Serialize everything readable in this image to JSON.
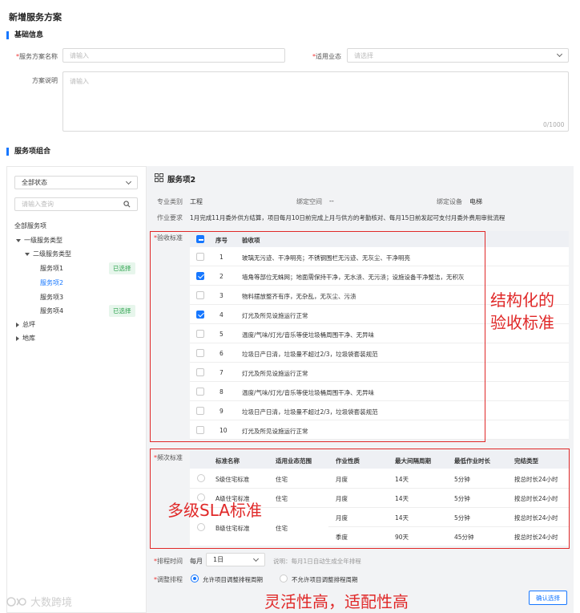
{
  "page_title": "新增服务方案",
  "basic": {
    "section_title": "基础信息",
    "name_label": "服务方案名称",
    "name_placeholder": "请输入",
    "biz_label": "适用业态",
    "biz_placeholder": "请选择",
    "desc_label": "方案说明",
    "desc_placeholder": "请输入",
    "desc_counter": "0/1000"
  },
  "combo": {
    "section_title": "服务项组合",
    "status_select": "全部状态",
    "search_placeholder": "请输入查询",
    "tree": {
      "root": "全部服务项",
      "level1": "一级服务类型",
      "level2": "二级服务类型",
      "items": [
        {
          "label": "服务项1",
          "tag": "已选择"
        },
        {
          "label": "服务项2",
          "tag": ""
        },
        {
          "label": "服务项3",
          "tag": ""
        },
        {
          "label": "服务项4",
          "tag": "已选择"
        }
      ],
      "other1": "总坪",
      "other2": "地库"
    }
  },
  "detail": {
    "title": "服务项2",
    "major_label": "专业类别",
    "major_value": "工程",
    "space_label": "绑定空间",
    "space_value": "--",
    "device_label": "绑定设备",
    "device_value": "电梯",
    "req_label": "作业要求",
    "req_value": "1月完成11月委外供方结算，项目每月10日前完成上月与供方的考勤核对、每月15日前发起可支付月委外费用审批流程",
    "accept_label": "验收标准",
    "accept_headers": {
      "no": "序号",
      "item": "验收项"
    },
    "accept_rows": [
      {
        "no": "1",
        "text": "玻璃无污迹、干净明亮；不锈钢围栏无污迹、无灰尘、干净明亮",
        "checked": false
      },
      {
        "no": "2",
        "text": "墙角等部位无蛛网；地面需保持干净，无水渍、无污渍；设施设备干净整洁，无积灰",
        "checked": true
      },
      {
        "no": "3",
        "text": "物料摆放整齐有序，无杂乱，无灰尘、污渍",
        "checked": false
      },
      {
        "no": "4",
        "text": "灯光及所见设施运行正常",
        "checked": true
      },
      {
        "no": "5",
        "text": "温度/气味/灯光/音乐等使垃圾桶周围干净、无异味",
        "checked": false
      },
      {
        "no": "6",
        "text": "垃圾日产日清，垃圾量不超过2/3，垃圾袋套装规范",
        "checked": false
      },
      {
        "no": "7",
        "text": "灯光及所见设施运行正常",
        "checked": false
      },
      {
        "no": "8",
        "text": "温度/气味/灯光/音乐等使垃圾桶周围干净、无异味",
        "checked": false
      },
      {
        "no": "9",
        "text": "垃圾日产日清，垃圾量不超过2/3，垃圾袋套装规范",
        "checked": false
      },
      {
        "no": "10",
        "text": "灯光及所见设施运行正常",
        "checked": false
      }
    ],
    "freq_label": "频次标准",
    "freq_headers": [
      "标准名称",
      "适用业态范围",
      "作业性质",
      "最大间隔周期",
      "最低作业时长",
      "完结类型"
    ],
    "freq_rows": [
      {
        "name": "S级住宅标准",
        "scope": "住宅",
        "nature": "月度",
        "cycle": "14天",
        "dur": "5分钟",
        "end": "按总时长24小时"
      },
      {
        "name": "A级住宅标准",
        "scope": "住宅",
        "nature": "月度",
        "cycle": "14天",
        "dur": "5分钟",
        "end": "按总时长24小时"
      },
      {
        "name": "",
        "scope": "",
        "nature": "月度",
        "cycle": "14天",
        "dur": "5分钟",
        "end": "按总时长24小时"
      },
      {
        "name": "B级住宅标准",
        "scope": "住宅",
        "nature": "季度",
        "cycle": "90天",
        "dur": "45分钟",
        "end": "按总时长24小时"
      }
    ],
    "sched_label": "排程时间",
    "sched_prefix": "每月",
    "sched_value": "1日",
    "sched_note": "说明：每月1日自动生成全年排程",
    "adjust_label": "调整排程",
    "adjust_opt1": "允许项目调整排程周期",
    "adjust_opt2": "不允许项目调整排程周期",
    "confirm_button": "确认选择"
  },
  "annotations": {
    "a1_line1": "结构化的",
    "a1_line2": "验收标准",
    "a2": "多级SLA标准",
    "a3": "灵活性高，适配性高"
  },
  "watermark": "大数跨境"
}
